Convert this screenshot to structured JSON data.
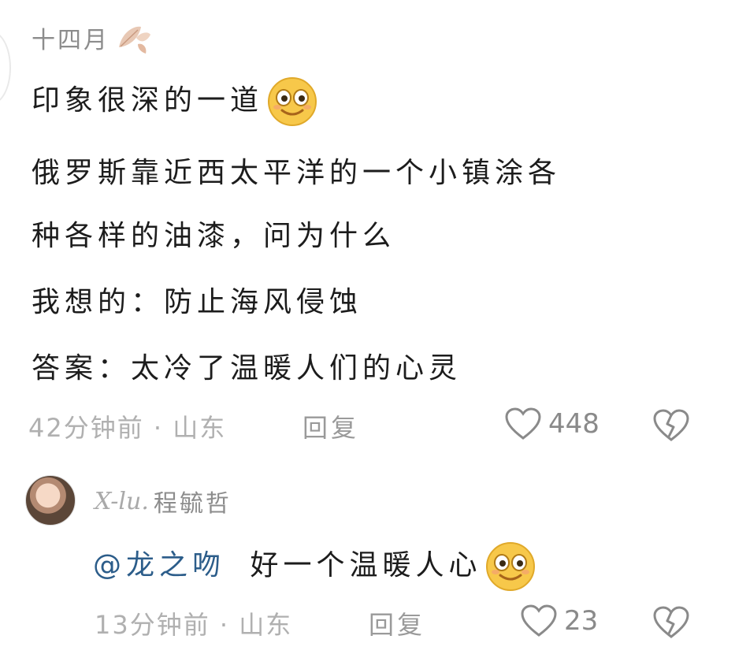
{
  "comment": {
    "username": "十四月",
    "text_lines": [
      "印象很深的一道",
      "俄罗斯靠近西太平洋的一个小镇涂各",
      "种各样的油漆，问为什么",
      "我想的：防止海风侵蚀",
      "答案：太冷了温暖人们的心灵"
    ],
    "time_location": "42分钟前 · 山东",
    "reply_label": "回复",
    "like_count": "448"
  },
  "reply": {
    "username_script": "X-lu.",
    "username": "程毓哲",
    "mention": "@龙之吻",
    "text": "好一个温暖人心",
    "time_location": "13分钟前 · 山东",
    "reply_label": "回复",
    "like_count": "23"
  },
  "icons": {
    "leaf": "autumn-leaf-icon",
    "emoji": "smiling-face-emoji",
    "like": "heart-outline-icon",
    "dislike": "broken-heart-icon"
  },
  "colors": {
    "text": "#1c1c1c",
    "muted": "#b0b0b0",
    "mention": "#2c5d8a",
    "emoji": "#f7c84a"
  }
}
